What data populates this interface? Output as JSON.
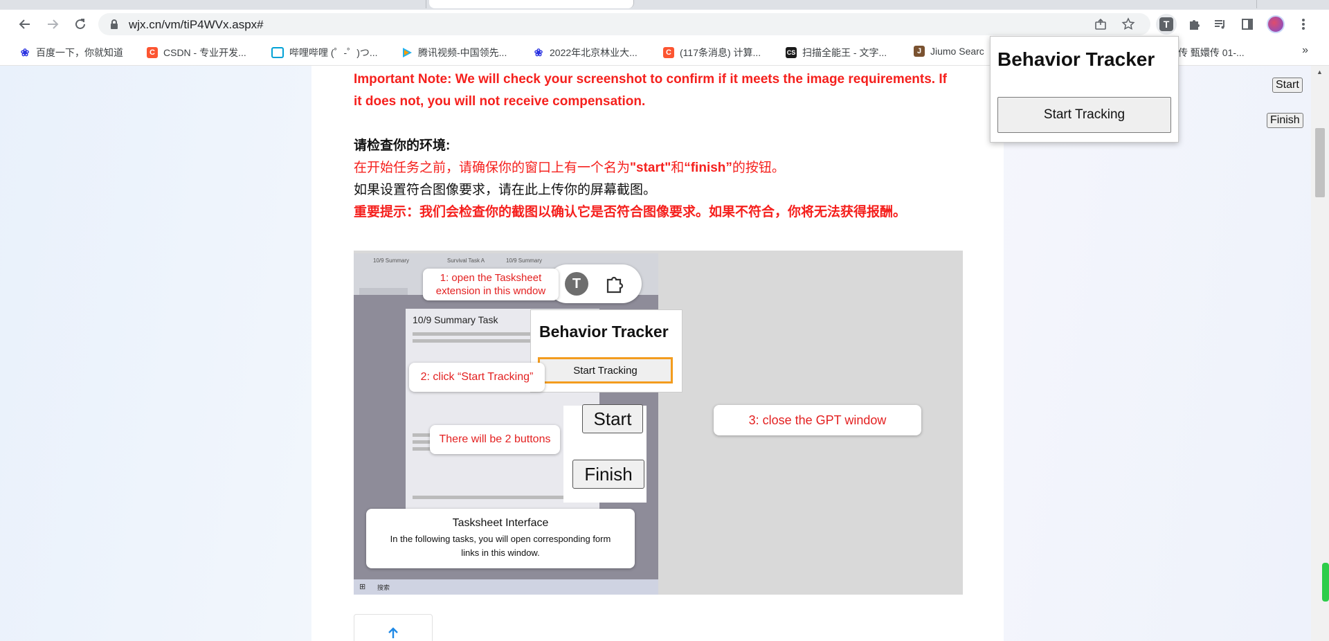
{
  "browser": {
    "url": "wjx.cn/vm/tiP4WVx.aspx#",
    "bookmarks": [
      {
        "label": "百度一下，你就知道",
        "icon": "baidu-paw-icon",
        "color": "#2932e1"
      },
      {
        "label": "CSDN - 专业开发...",
        "icon": "csdn-icon",
        "color": "#fc5531"
      },
      {
        "label": "哔哩哔哩 (゜-゜)つ...",
        "icon": "bilibili-icon",
        "color": "#00a1d6"
      },
      {
        "label": "腾讯视频-中国领先...",
        "icon": "tencent-video-icon",
        "color": "#20b2f0"
      },
      {
        "label": "2022年北京林业大...",
        "icon": "baidu-paw-icon",
        "color": "#2932e1"
      },
      {
        "label": "(117条消息) 计算...",
        "icon": "csdn-icon",
        "color": "#fc5531"
      },
      {
        "label": "扫描全能王 - 文字...",
        "icon": "camscanner-icon",
        "color": "#1a1a1a"
      },
      {
        "label": "Jiumo Searc",
        "icon": "jiumo-icon",
        "color": "#7a5230"
      },
      {
        "label": "传 甄嬛传 01-...",
        "icon": "",
        "color": ""
      }
    ],
    "more_glyph": "»"
  },
  "page": {
    "note_en": "Important Note: We will check your screenshot to confirm if it meets the image requirements. If it does not, you will not receive compensation.",
    "env_heading": "请检查你的环境:",
    "env_line1_a": "在开始任务之前，请确保你的窗口上有一个名为",
    "env_line1_start": "\"start\"",
    "env_line1_b": "和",
    "env_line1_finish": "“finish”",
    "env_line1_c": "的按钮。",
    "env_line2": "如果设置符合图像要求，请在此上传你的屏幕截图。",
    "note_zh": "重要提示：我们会检查你的截图以确认它是否符合图像要求。如果不符合，你将无法获得报酬。",
    "figure": {
      "callout1": "1: open the Tasksheet extension in this wndow",
      "tracker_title": "Behavior Tracker",
      "tracker_button": "Start Tracking",
      "callout2": "2: click “Start Tracking”",
      "callout_buttons": "There will be 2 buttons",
      "start": "Start",
      "finish": "Finish",
      "callout3": "3: close the GPT window",
      "interface_title": "Tasksheet Interface",
      "interface_desc": "In the following tasks, you will open corresponding form links in this window.",
      "doc_title": "10/9 Summary Task",
      "tab1": "10/9 Summary",
      "tab2": "Survival Task A",
      "tab3": "10/9 Summary",
      "search_label": "搜索"
    },
    "side_start": "Start",
    "side_finish": "Finish"
  },
  "popup": {
    "title": "Behavior Tracker",
    "button": "Start Tracking"
  }
}
